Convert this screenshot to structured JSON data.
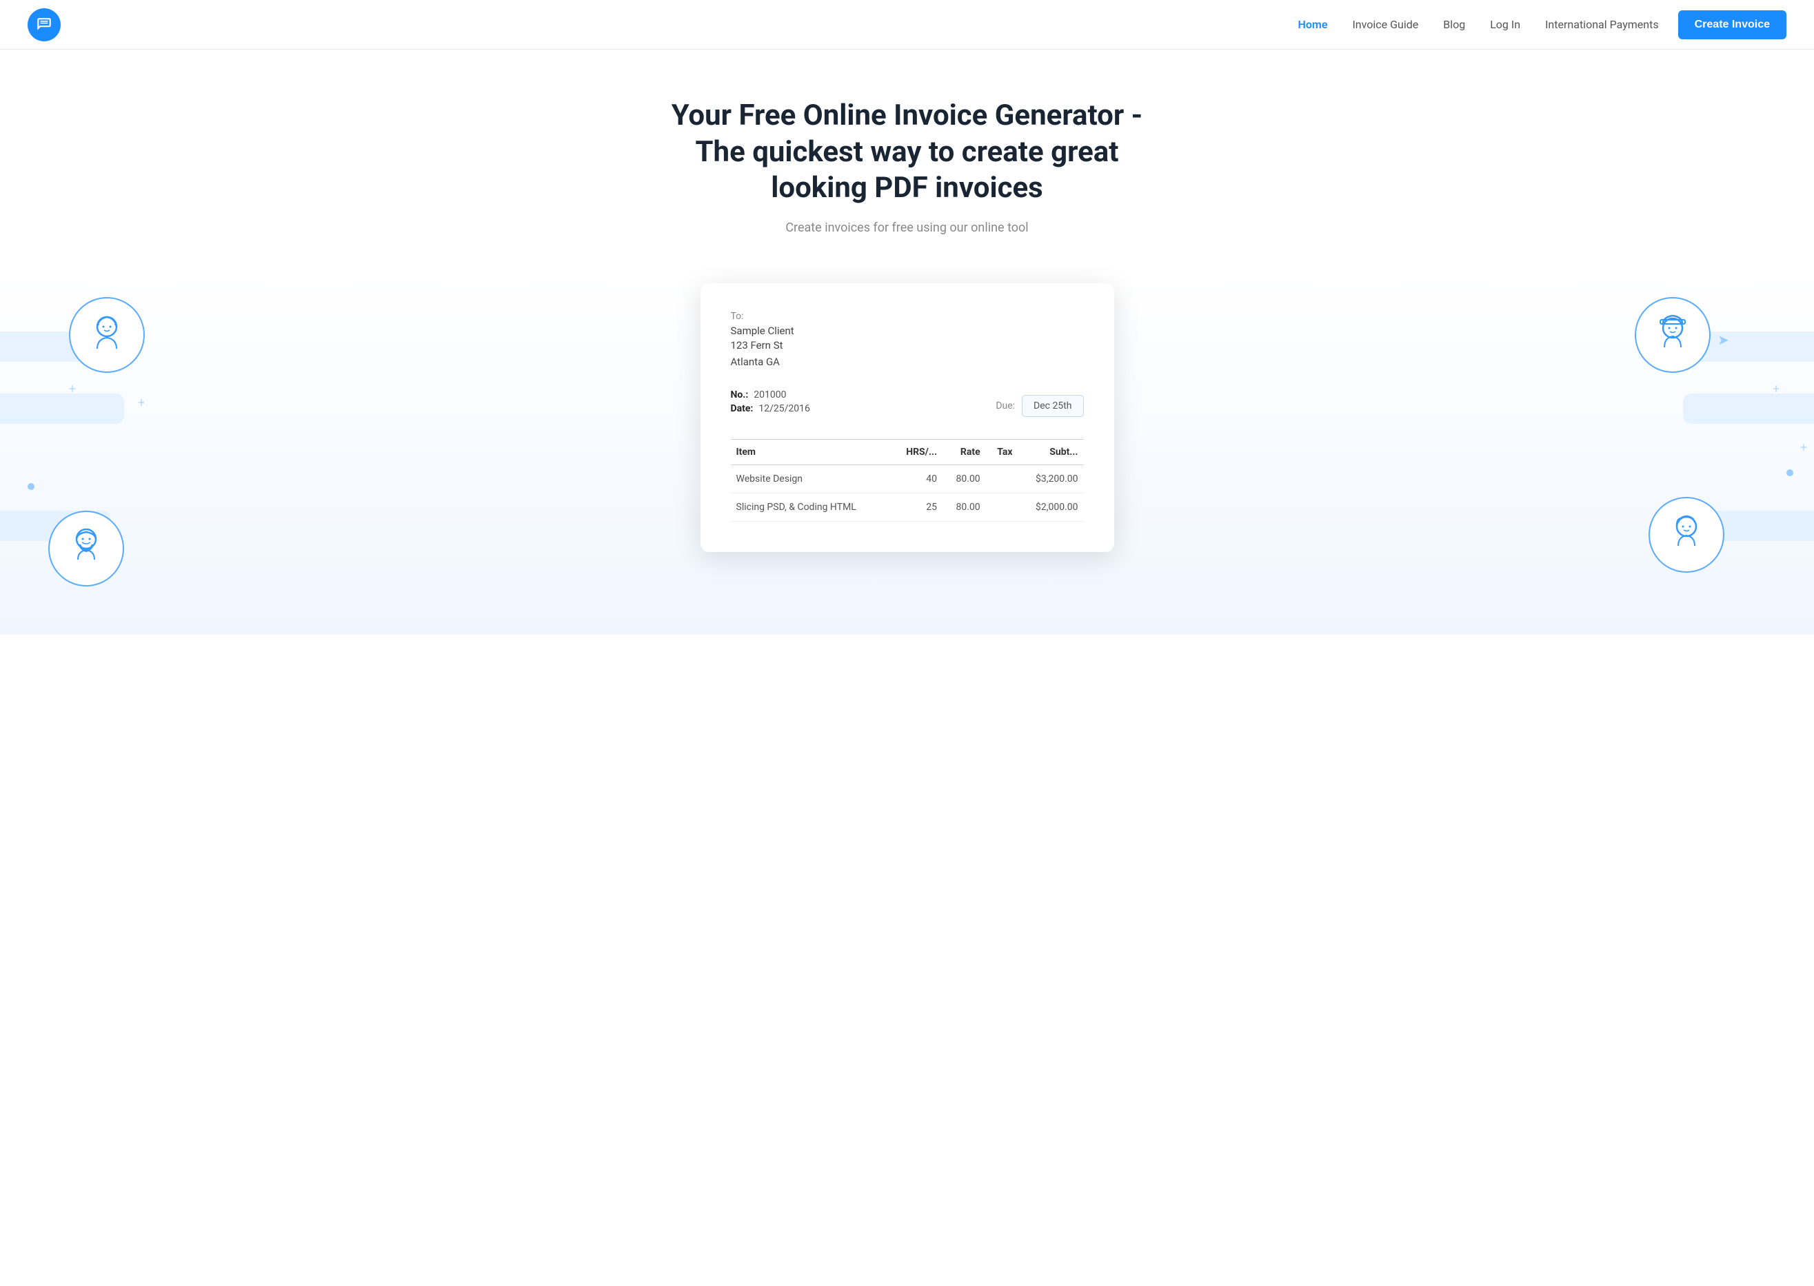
{
  "header": {
    "logo_alt": "Invoice Generator Logo",
    "nav": {
      "home": "Home",
      "invoice_guide": "Invoice Guide",
      "blog": "Blog",
      "log_in": "Log In",
      "international_payments": "International Payments"
    },
    "cta_label": "Create Invoice"
  },
  "hero": {
    "headline": "Your Free Online Invoice Generator - The quickest way to create great looking PDF invoices",
    "subtext": "Create invoices for free using our online tool"
  },
  "invoice": {
    "to_label": "To:",
    "client_name": "Sample Client",
    "address_line1": "123 Fern St",
    "address_line2": "Atlanta GA",
    "number_label": "No.:",
    "number_value": "201000",
    "date_label": "Date:",
    "date_value": "12/25/2016",
    "due_label": "Due:",
    "due_date": "Dec 25th",
    "table": {
      "headers": [
        "Item",
        "HRS/...",
        "Rate",
        "Tax",
        "Subt..."
      ],
      "rows": [
        [
          "Website Design",
          "40",
          "80.00",
          "",
          "$3,200.00"
        ],
        [
          "Slicing PSD, & Coding HTML",
          "25",
          "80.00",
          "",
          "$2,000.00"
        ]
      ]
    }
  },
  "colors": {
    "brand_blue": "#1a8cff",
    "light_blue": "#ddeeff",
    "text_dark": "#1a2533",
    "text_muted": "#888888"
  }
}
